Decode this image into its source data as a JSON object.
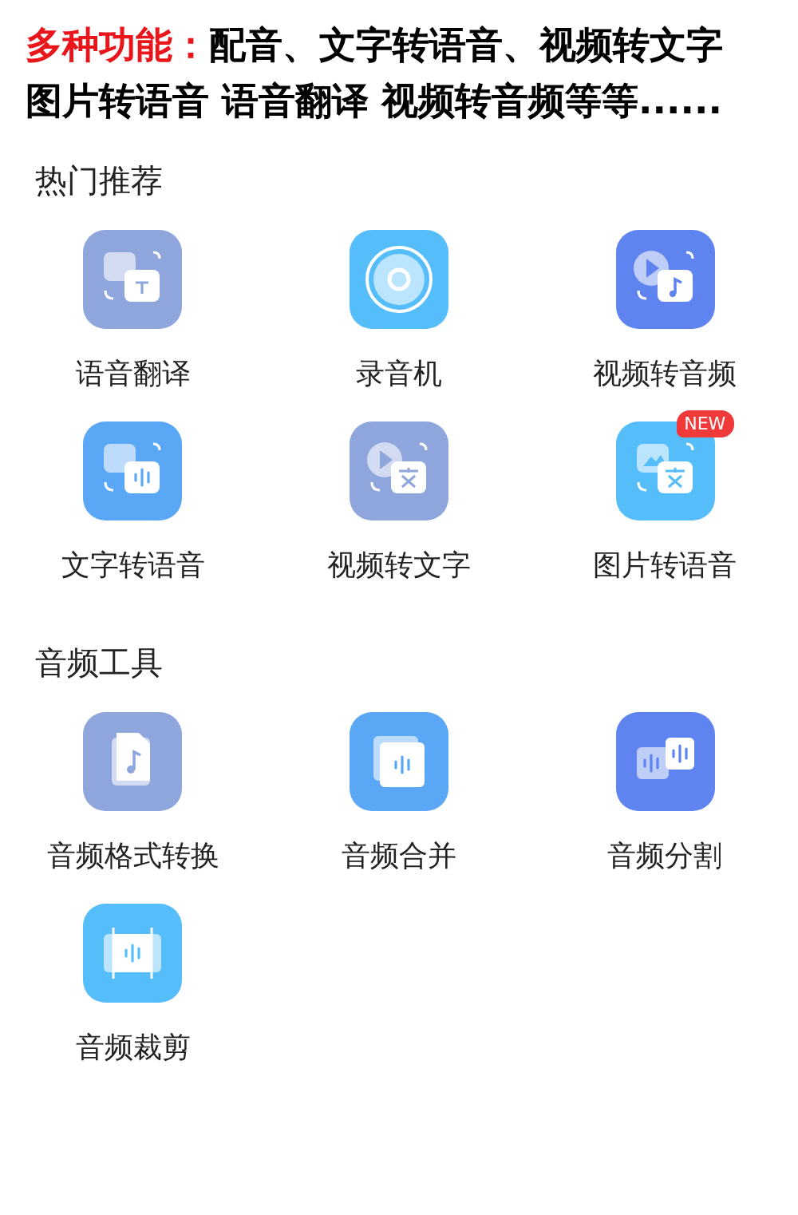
{
  "banner": {
    "label": "多种功能：",
    "line_1": "配音、文字转语音、视频转文字",
    "line_2": "图片转语音 语音翻译 视频转音频等等......"
  },
  "sections": [
    {
      "title": "热门推荐",
      "items": [
        {
          "label": "语音翻译",
          "kind": "translate",
          "color": "#8fa6dc"
        },
        {
          "label": "录音机",
          "kind": "record",
          "color": "#55bdfa"
        },
        {
          "label": "视频转音频",
          "kind": "video-audio",
          "color": "#5f84f0"
        },
        {
          "label": "文字转语音",
          "kind": "text-speech",
          "color": "#5aa8f5"
        },
        {
          "label": "视频转文字",
          "kind": "video-text",
          "color": "#8fa6dc"
        },
        {
          "label": "图片转语音",
          "kind": "image-text",
          "color": "#55bdfa",
          "badge": "NEW"
        }
      ]
    },
    {
      "title": "音频工具",
      "items": [
        {
          "label": "音频格式转换",
          "kind": "audio-file",
          "color": "#8fa6dc"
        },
        {
          "label": "音频合并",
          "kind": "merge",
          "color": "#5aa8f5"
        },
        {
          "label": "音频分割",
          "kind": "split",
          "color": "#5f84f0"
        },
        {
          "label": "音频裁剪",
          "kind": "trim",
          "color": "#55bdfa"
        }
      ]
    }
  ]
}
